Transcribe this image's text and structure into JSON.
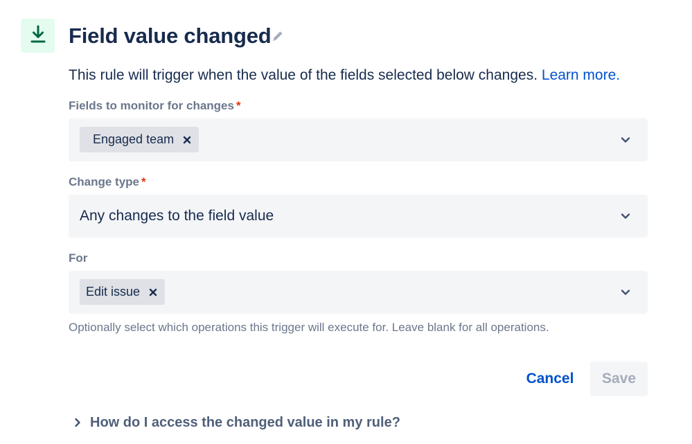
{
  "header": {
    "icon": "download-arrow-icon",
    "title": "Field value changed",
    "edit_icon": "pencil-icon"
  },
  "description": {
    "text": "This rule will trigger when the value of the fields selected below changes.",
    "link": "Learn more."
  },
  "fields_to_monitor": {
    "label": "Fields to monitor for changes",
    "required_mark": "*",
    "chips": [
      {
        "label": "Engaged team"
      }
    ]
  },
  "change_type": {
    "label": "Change type",
    "required_mark": "*",
    "value": "Any changes to the field value"
  },
  "for_field": {
    "label": "For",
    "chips": [
      {
        "label": "Edit issue"
      }
    ],
    "helper": "Optionally select which operations this trigger will execute for. Leave blank for all operations."
  },
  "actions": {
    "cancel": "Cancel",
    "save": "Save"
  },
  "faq": {
    "label": "How do I access the changed value in my rule?"
  },
  "colors": {
    "icon_bg": "#e3fcef",
    "icon_fg": "#006644",
    "link": "#0052cc",
    "required": "#de350b",
    "input_bg": "#f4f5f7",
    "chip_bg": "#dfe1e6"
  }
}
